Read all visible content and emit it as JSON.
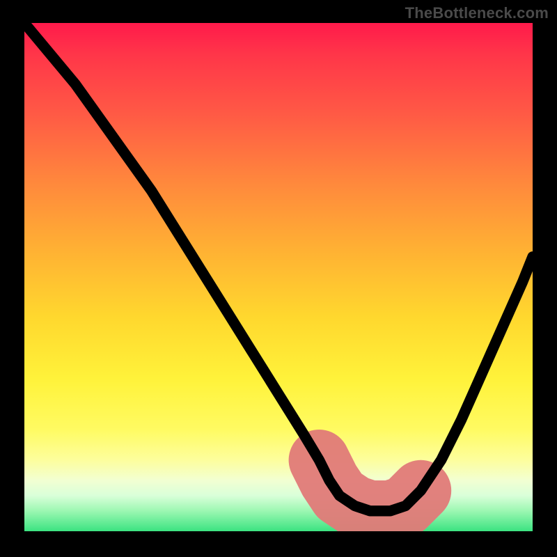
{
  "watermark": "TheBottleneck.com",
  "colors": {
    "page_bg": "#000000",
    "watermark_text": "#4a4a4a",
    "curve_stroke": "#000000",
    "highlight_stroke": "#e07a78",
    "gradient_stops": [
      "#ff1a4b",
      "#ff3549",
      "#ff5a45",
      "#ff8a3c",
      "#ffb233",
      "#ffd82e",
      "#fff23a",
      "#fffb62",
      "#fdfe9d",
      "#f2ffd2",
      "#d9ffd9",
      "#9cf7b2",
      "#3be381"
    ]
  },
  "chart_data": {
    "type": "line",
    "title": "",
    "xlabel": "",
    "ylabel": "",
    "xlim": [
      0,
      100
    ],
    "ylim": [
      0,
      100
    ],
    "grid": false,
    "legend": false,
    "note": "Values estimated from pixel positions. x and y in 0–100 normalized units; origin at bottom-left of the colored plot area. The curve is a steep descending left branch, a flat trough around x≈62–75, and a rising right branch.",
    "series": [
      {
        "name": "curve",
        "x": [
          0,
          5,
          10,
          15,
          20,
          25,
          30,
          35,
          40,
          45,
          50,
          55,
          58,
          60,
          62,
          65,
          68,
          72,
          75,
          78,
          82,
          86,
          90,
          94,
          98,
          100
        ],
        "y": [
          100,
          94,
          88,
          81,
          74,
          67,
          59,
          51,
          43,
          35,
          27,
          19,
          14,
          10,
          7,
          5,
          4,
          4,
          5,
          8,
          14,
          22,
          31,
          40,
          49,
          54
        ]
      },
      {
        "name": "highlight-band",
        "x": [
          58,
          60,
          62,
          65,
          68,
          72,
          75,
          78
        ],
        "y": [
          14,
          10,
          7,
          5,
          4,
          4,
          5,
          8
        ]
      }
    ]
  }
}
